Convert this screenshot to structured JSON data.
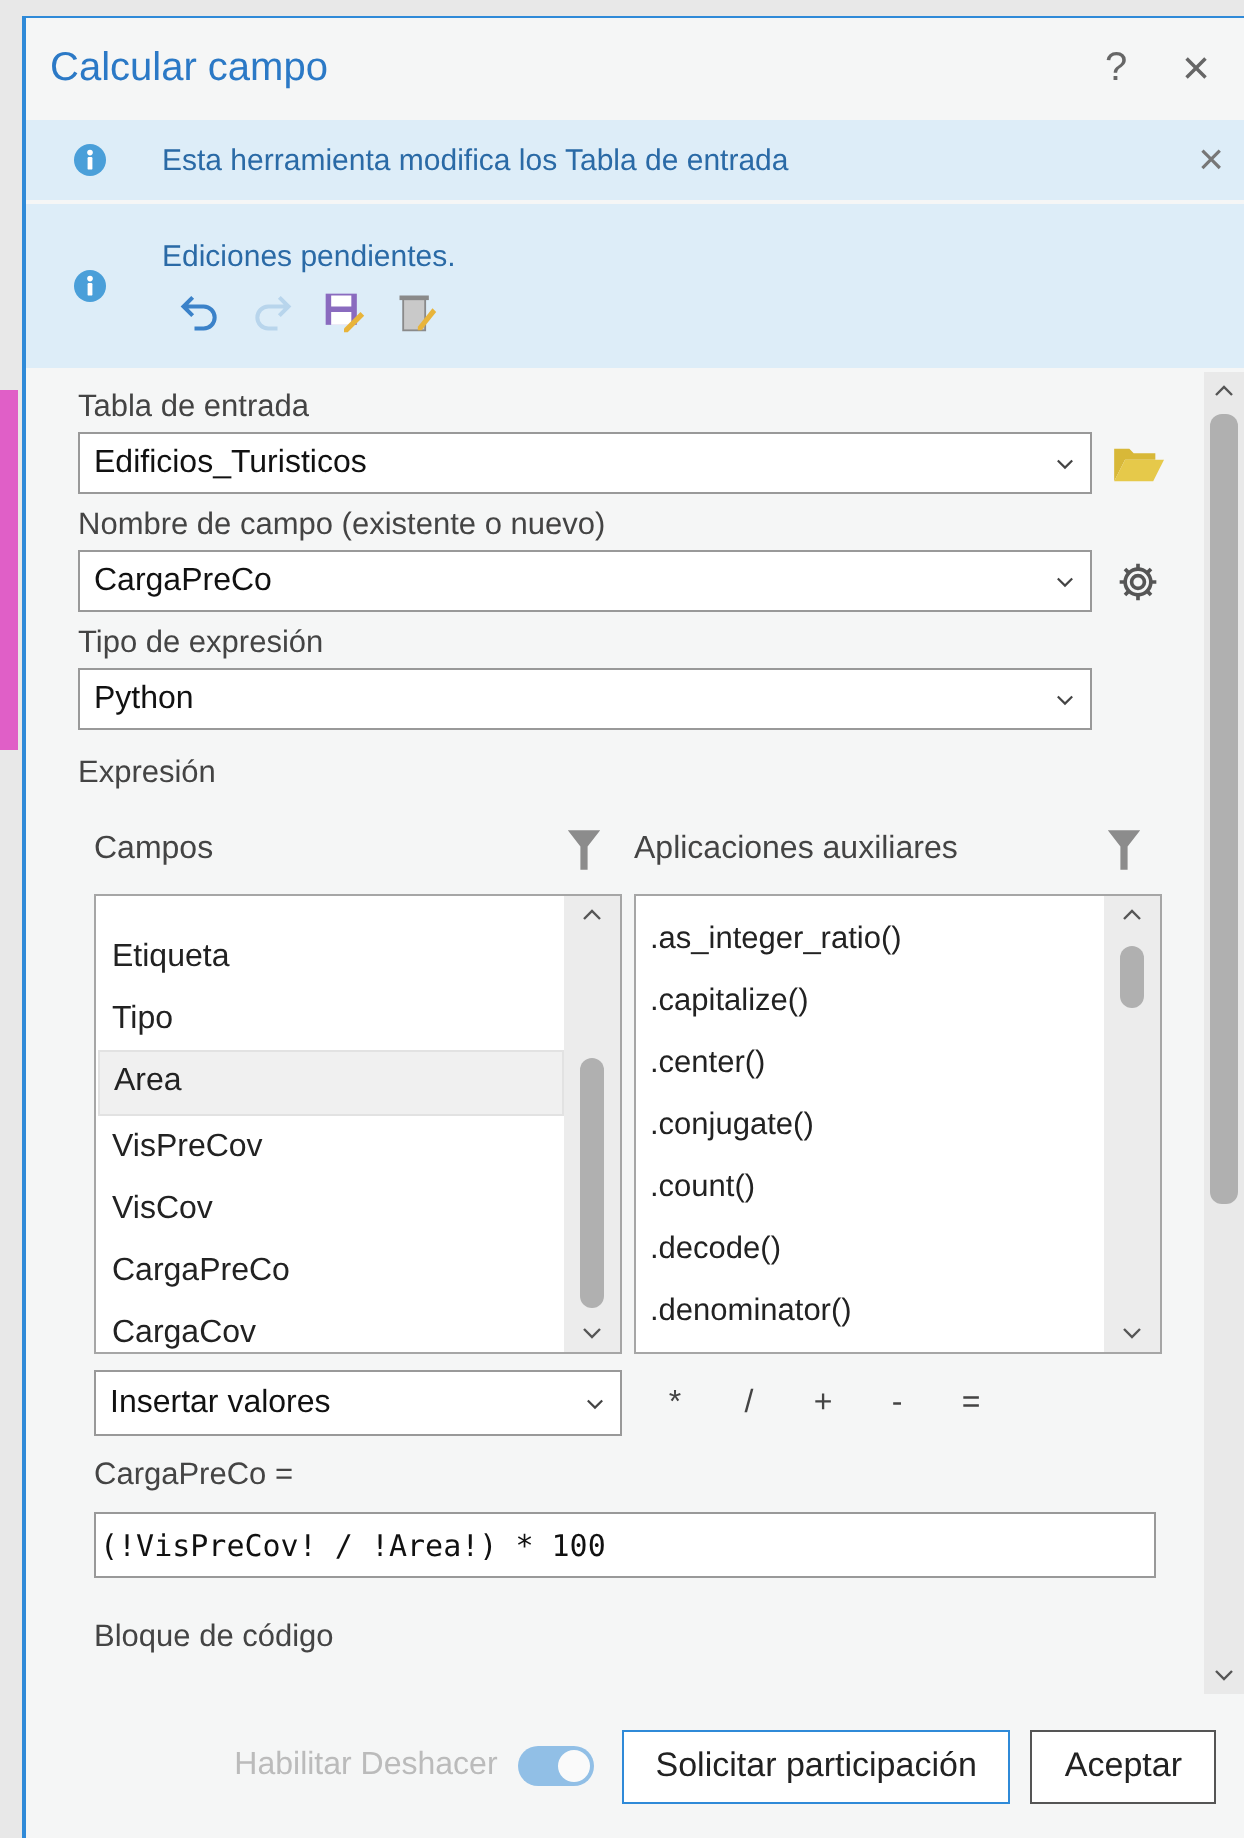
{
  "dialog": {
    "title": "Calcular campo",
    "help": "?",
    "close": "×"
  },
  "messages": [
    {
      "kind": "notice",
      "text": "Esta herramienta modifica los Tabla de entrada",
      "closable": true,
      "close": "×"
    },
    {
      "kind": "edits",
      "text": "Ediciones pendientes.",
      "closable": false,
      "tools": [
        {
          "kind": "undo",
          "disabled": false
        },
        {
          "kind": "redo",
          "disabled": true
        },
        {
          "kind": "save",
          "disabled": false
        },
        {
          "kind": "discard",
          "disabled": false
        }
      ]
    }
  ],
  "parameters": [
    {
      "label": "Tabla de entrada",
      "value": "Edificios_Turisticos",
      "kind": "dataset"
    },
    {
      "label": "Nombre de campo (existente o nuevo)",
      "value": "CargaPreCo",
      "kind": "field"
    },
    {
      "label": "Tipo de expresión",
      "value": "Python",
      "kind": "choice"
    }
  ],
  "expression": {
    "label": "Expresión",
    "fields": {
      "title": "Campos",
      "items": [
        {
          "label": "Etiqueta",
          "selected": false
        },
        {
          "label": "Tipo",
          "selected": false
        },
        {
          "label": "Area",
          "selected": true
        },
        {
          "label": "VisPreCov",
          "selected": false
        },
        {
          "label": "VisCov",
          "selected": false
        },
        {
          "label": "CargaPreCo",
          "selected": false
        },
        {
          "label": "CargaCov",
          "selected": false
        }
      ]
    },
    "helpers": {
      "title": "Aplicaciones auxiliares",
      "items": [
        ".as_integer_ratio()",
        ".capitalize()",
        ".center()",
        ".conjugate()",
        ".count()",
        ".decode()",
        ".denominator()"
      ]
    },
    "insert_values": "Insertar valores",
    "operators": [
      "*",
      "/",
      "+",
      "-",
      "="
    ],
    "target_label": "CargaPreCo =",
    "value": "(!VisPreCov! / !Area!) * 100",
    "code_block_label": "Bloque de código"
  },
  "footer": {
    "toggle": {
      "label": "Habilitar Deshacer",
      "on": true,
      "disabled": true
    },
    "buttons": [
      {
        "label": "Solicitar participación",
        "focused": true
      },
      {
        "label": "Aceptar",
        "focused": false
      }
    ]
  }
}
